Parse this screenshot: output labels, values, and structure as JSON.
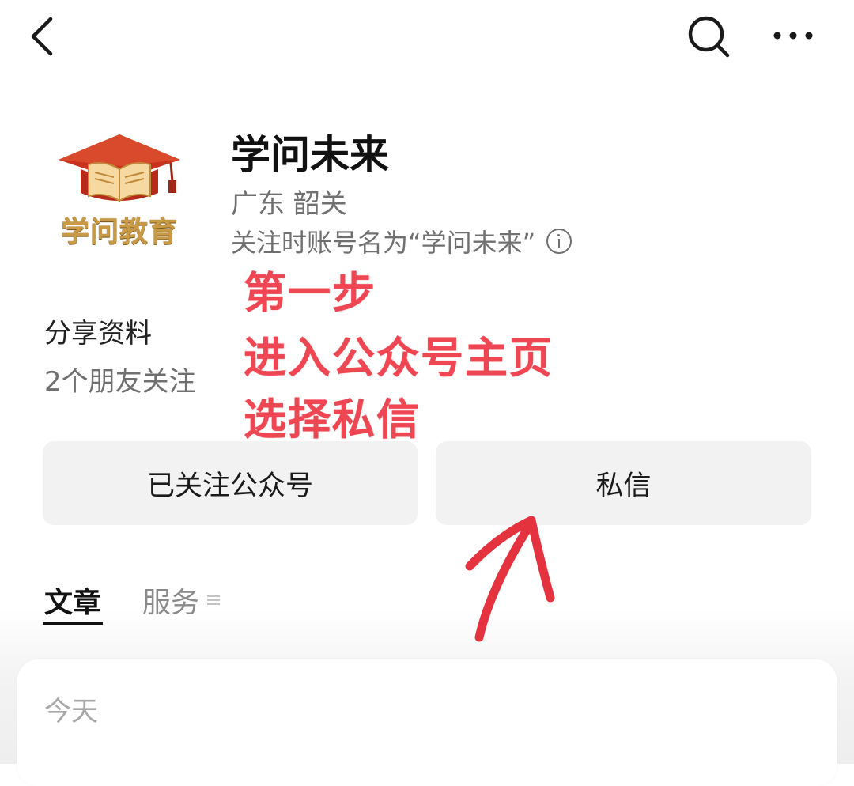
{
  "profile": {
    "name": "学问未来",
    "location": "广东 韶关",
    "follow_name_note": "关注时账号名为“学问未来”",
    "avatar_text": "学问教育",
    "share_label": "分享资料",
    "friends_follow": "2个朋友关注"
  },
  "annotation": {
    "step": "第一步",
    "line1": "进入公众号主页",
    "line2": "选择私信"
  },
  "actions": {
    "followed_label": "已关注公众号",
    "message_label": "私信"
  },
  "tabs": [
    {
      "label": "文章",
      "active": true
    },
    {
      "label": "服务",
      "active": false
    }
  ],
  "articles": {
    "section_label": "今天"
  },
  "icons": {
    "back": "back-chevron-icon",
    "search": "search-icon",
    "more": "more-dots-icon",
    "info": "info-icon",
    "menu": "menu-icon",
    "arrow": "red-arrow-icon"
  },
  "colors": {
    "annotation": "#ef4653",
    "button_bg": "#f2f2f2",
    "secondary_text": "#707070"
  }
}
